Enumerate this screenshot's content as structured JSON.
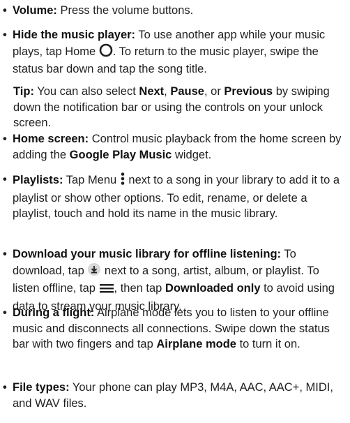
{
  "items": [
    {
      "title": "Volume:",
      "text": " Press the volume buttons."
    },
    {
      "title": "Hide the music player:",
      "text_a": " To use another app while your music plays, tap Home ",
      "icon": "home-circle-icon",
      "text_b": ". To return to the music player, swipe the status bar down and tap the song title."
    },
    {
      "title": "Home screen:",
      "text_a": " Control music playback from the home screen by adding the ",
      "bold": "Google Play Music",
      "text_b": " widget."
    },
    {
      "title": "Playlists:",
      "text_a": " Tap Menu ",
      "icon": "menu-dots-icon",
      "text_b": " next to a song in your library to add it to a playlist or show other options. To edit, rename, or delete a playlist, touch and hold its name in the music library."
    },
    {
      "title": "Download your music library for offline listening:",
      "text_a": " To download, tap ",
      "icon1": "download-icon",
      "text_b": " next to a song, artist, album, or playlist. To listen offline, tap ",
      "icon2": "hamburger-menu-icon",
      "text_c": ", then tap ",
      "bold": "Downloaded only",
      "text_d": " to avoid using data to stream your music library."
    },
    {
      "title": "During a flight:",
      "text_a": " Airplane mode lets you to listen to your offline music and disconnects all connections. Swipe down the status bar with two fingers and tap ",
      "bold": "Airplane mode",
      "text_b": " to turn it on."
    },
    {
      "title": "File types:",
      "text": " Your phone can play MP3, M4A, AAC, AAC+, MIDI, and WAV files."
    }
  ],
  "tip": {
    "label": "Tip:",
    "text_a": " You can also select ",
    "next": "Next",
    "sep1": ", ",
    "pause": "Pause",
    "sep2": ", or ",
    "previous": "Previous",
    "text_b": " by swiping down the notification bar or using the controls on your unlock screen."
  },
  "bullet": "•"
}
